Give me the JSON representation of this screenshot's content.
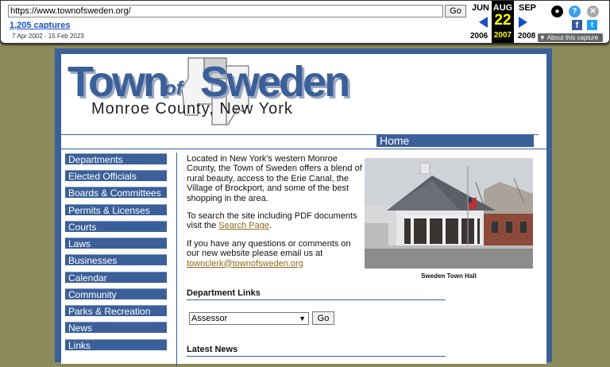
{
  "wayback": {
    "url": "https://www.townofsweden.org/",
    "go_label": "Go",
    "captures": "1,205 captures",
    "range": "7 Apr 2002 - 15 Feb 2023",
    "prev_month": "JUN",
    "prev_year": "2006",
    "cur_month": "AUG",
    "cur_day": "22",
    "cur_year": "2007",
    "next_month": "SEP",
    "next_year": "2008",
    "about": "About this capture"
  },
  "header": {
    "town": "Town",
    "of": "of",
    "sweden": "Sweden",
    "subtitle": "Monroe County, New York",
    "home_tab": "Home"
  },
  "sidebar": {
    "items": [
      "Departments",
      "Elected Officials",
      "Boards & Committees",
      "Permits & Licenses",
      "Courts",
      "Laws",
      "Businesses",
      "Calendar",
      "Community",
      "Parks & Recreation",
      "News",
      "Links"
    ]
  },
  "main": {
    "intro1": "Located in New York's western Monroe County, the Town of Sweden offers a blend of rural beauty, access to the Erie Canal, the Village of Brockport, and some of the best shopping in the area.",
    "intro2_pre": "To search the site including PDF documents visit the ",
    "intro2_link": "Search Page",
    "intro2_post": ".",
    "intro3": "If you have any questions or comments on our new website please email us at",
    "email": "townclerk@townofsweden.org",
    "photo_caption": "Sweden Town Hall",
    "dept_links_title": "Department Links",
    "dept_selected": "Assessor",
    "dept_go": "Go",
    "latest_news_title": "Latest News"
  }
}
